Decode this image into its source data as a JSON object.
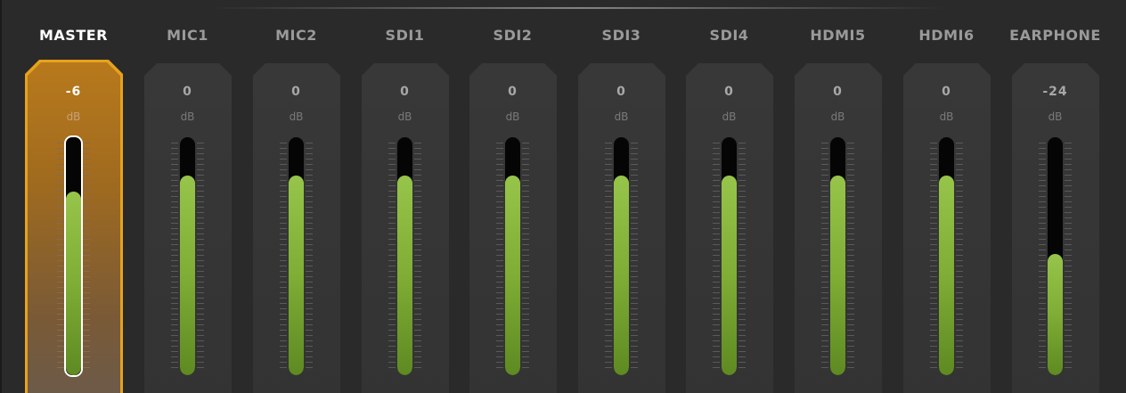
{
  "mixer": {
    "channels": [
      {
        "name": "MASTER",
        "value": "-6",
        "unit": "dB",
        "level": 0.77,
        "selected": true
      },
      {
        "name": "MIC1",
        "value": "0",
        "unit": "dB",
        "level": 0.84,
        "selected": false
      },
      {
        "name": "MIC2",
        "value": "0",
        "unit": "dB",
        "level": 0.84,
        "selected": false
      },
      {
        "name": "SDI1",
        "value": "0",
        "unit": "dB",
        "level": 0.84,
        "selected": false
      },
      {
        "name": "SDI2",
        "value": "0",
        "unit": "dB",
        "level": 0.84,
        "selected": false
      },
      {
        "name": "SDI3",
        "value": "0",
        "unit": "dB",
        "level": 0.84,
        "selected": false
      },
      {
        "name": "SDI4",
        "value": "0",
        "unit": "dB",
        "level": 0.84,
        "selected": false
      },
      {
        "name": "HDMI5",
        "value": "0",
        "unit": "dB",
        "level": 0.84,
        "selected": false
      },
      {
        "name": "HDMI6",
        "value": "0",
        "unit": "dB",
        "level": 0.84,
        "selected": false
      },
      {
        "name": "EARPHONE",
        "value": "-24",
        "unit": "dB",
        "level": 0.51,
        "selected": false
      }
    ]
  },
  "colors": {
    "accent": "#e8a21a",
    "meter_green": "#8dbb3f",
    "background": "#2a2a2a"
  }
}
